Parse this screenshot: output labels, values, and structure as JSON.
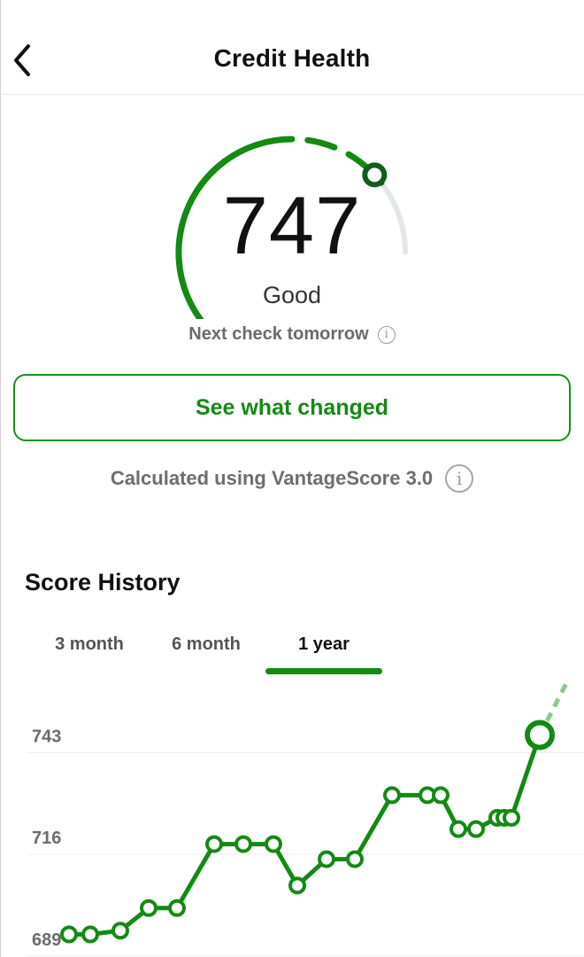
{
  "header": {
    "title": "Credit Health",
    "back_icon": "chevron-left-icon"
  },
  "score": {
    "value": "747",
    "rating": "Good",
    "next_check": "Next check tomorrow",
    "gauge_fraction": 0.82,
    "colors": {
      "arc": "#138a13",
      "track": "#e4e6ea",
      "knob": "#0f5f1a"
    }
  },
  "cta": {
    "label": "See what changed"
  },
  "model": {
    "text": "Calculated using VantageScore 3.0"
  },
  "history": {
    "title": "Score History",
    "tabs": [
      {
        "label": "3 month",
        "active": false
      },
      {
        "label": "6 month",
        "active": false
      },
      {
        "label": "1 year",
        "active": true
      }
    ]
  },
  "chart_data": {
    "type": "line",
    "y_ticks": [
      689,
      716,
      743
    ],
    "ylim": [
      684,
      757
    ],
    "values": [
      690,
      690,
      691,
      697,
      697,
      714,
      714,
      714,
      703,
      710,
      710,
      727,
      727,
      727,
      718,
      718,
      721,
      721,
      721,
      743
    ],
    "colors": {
      "line": "#138a13",
      "point_fill": "#ffffff",
      "projection": "#8cc88c"
    }
  }
}
